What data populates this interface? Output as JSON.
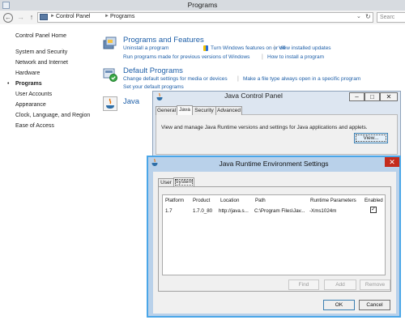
{
  "window": {
    "title": "Programs"
  },
  "address": {
    "crumbs": [
      "Control Panel",
      "Programs"
    ],
    "search_placeholder": "Searc"
  },
  "nav": {
    "home": "Control Panel Home",
    "items": [
      "System and Security",
      "Network and Internet",
      "Hardware",
      "Programs",
      "User Accounts",
      "Appearance",
      "Clock, Language, and Region",
      "Ease of Access"
    ]
  },
  "programs_features": {
    "title": "Programs and Features",
    "links": [
      "Uninstall a program",
      "Turn Windows features on or off",
      "View installed updates",
      "Run programs made for previous versions of Windows",
      "How to install a program"
    ]
  },
  "default_programs": {
    "title": "Default Programs",
    "links": [
      "Change default settings for media or devices",
      "Make a file type always open in a specific program",
      "Set your default programs"
    ]
  },
  "java_section": {
    "title": "Java"
  },
  "java_cp": {
    "title": "Java Control Panel",
    "tabs": [
      "General",
      "Java",
      "Security",
      "Advanced"
    ],
    "description": "View and manage Java Runtime versions and settings for Java applications and applets.",
    "view_button": "View..."
  },
  "jre_settings": {
    "title": "Java Runtime Environment Settings",
    "tabs": [
      "User",
      "System"
    ],
    "columns": [
      "Platform",
      "Product",
      "Location",
      "Path",
      "Runtime Parameters",
      "Enabled"
    ],
    "rows": [
      {
        "platform": "1.7",
        "product": "1.7.0_80",
        "location": "http://java.s...",
        "path": "C:\\Program Files\\Jav...",
        "params": "-Xms1024m",
        "enabled": true
      }
    ],
    "buttons": {
      "find": "Find",
      "add": "Add",
      "remove": "Remove",
      "ok": "OK",
      "cancel": "Cancel"
    }
  },
  "colors": {
    "link": "#1e5fa8",
    "close_red": "#c42b1c",
    "jre_border": "#4aa6e8"
  }
}
